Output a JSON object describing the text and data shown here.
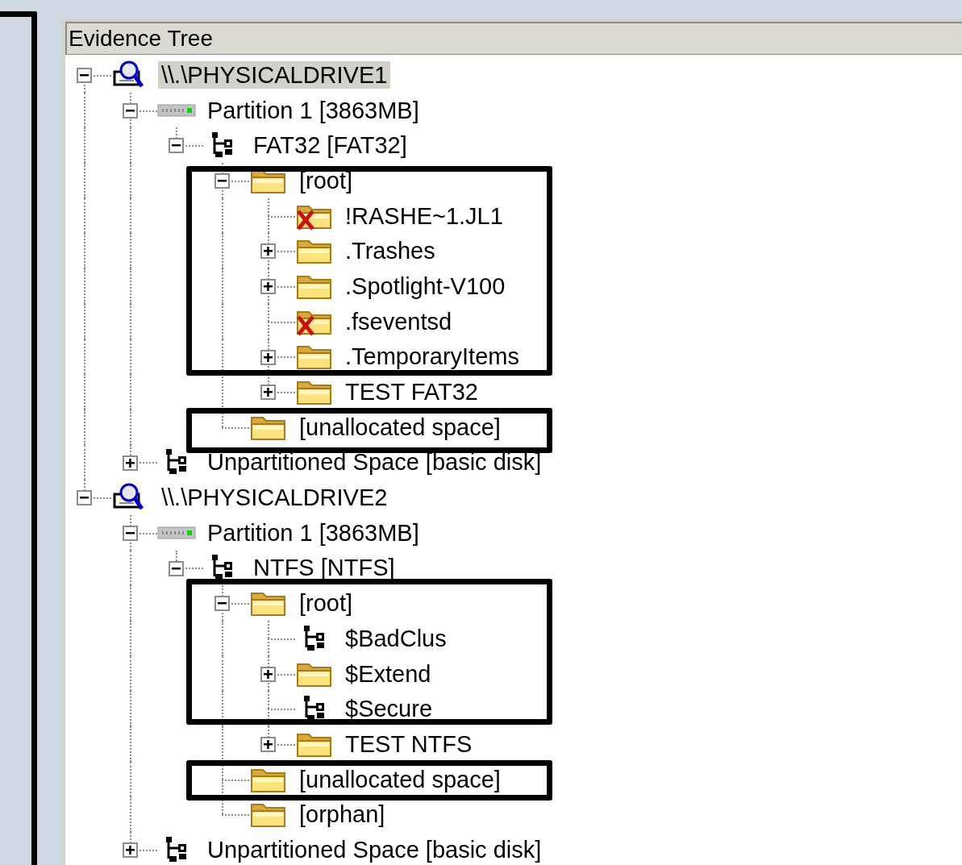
{
  "panel": {
    "title": "Evidence Tree"
  },
  "tree": [
    {
      "label": "\\\\.\\PHYSICALDRIVE1",
      "kind": "drive",
      "selected": true,
      "expanded": true,
      "children": [
        {
          "label": "Partition 1 [3863MB]",
          "kind": "partition",
          "selected": false,
          "expanded": true,
          "children": [
            {
              "label": "FAT32 [FAT32]",
              "kind": "filesystem",
              "selected": false,
              "expanded": true,
              "children": [
                {
                  "label": "[root]",
                  "kind": "folder",
                  "selected": false,
                  "expanded": true,
                  "children": [
                    {
                      "label": "!RASHE~1.JL1",
                      "kind": "deleted-folder",
                      "selected": false
                    },
                    {
                      "label": ".Trashes",
                      "kind": "folder",
                      "selected": false,
                      "expanded": false
                    },
                    {
                      "label": ".Spotlight-V100",
                      "kind": "folder",
                      "selected": false,
                      "expanded": false
                    },
                    {
                      "label": ".fseventsd",
                      "kind": "deleted-folder",
                      "selected": false
                    },
                    {
                      "label": ".TemporaryItems",
                      "kind": "folder",
                      "selected": false,
                      "expanded": false
                    },
                    {
                      "label": "TEST FAT32",
                      "kind": "folder",
                      "selected": false,
                      "expanded": false
                    }
                  ]
                },
                {
                  "label": "[unallocated space]",
                  "kind": "folder",
                  "selected": false
                }
              ]
            }
          ]
        },
        {
          "label": "Unpartitioned Space [basic disk]",
          "kind": "filesystem",
          "selected": false,
          "expanded": false
        }
      ]
    },
    {
      "label": "\\\\.\\PHYSICALDRIVE2",
      "kind": "drive",
      "selected": false,
      "expanded": true,
      "children": [
        {
          "label": "Partition 1 [3863MB]",
          "kind": "partition",
          "selected": false,
          "expanded": true,
          "children": [
            {
              "label": "NTFS [NTFS]",
              "kind": "filesystem",
              "selected": false,
              "expanded": true,
              "children": [
                {
                  "label": "[root]",
                  "kind": "folder",
                  "selected": false,
                  "expanded": true,
                  "children": [
                    {
                      "label": "$BadClus",
                      "kind": "filesystem",
                      "selected": false
                    },
                    {
                      "label": "$Extend",
                      "kind": "folder",
                      "selected": false,
                      "expanded": false
                    },
                    {
                      "label": "$Secure",
                      "kind": "filesystem",
                      "selected": false
                    },
                    {
                      "label": "TEST NTFS",
                      "kind": "folder",
                      "selected": false,
                      "expanded": false
                    }
                  ]
                },
                {
                  "label": "[unallocated space]",
                  "kind": "folder",
                  "selected": false
                },
                {
                  "label": "[orphan]",
                  "kind": "folder",
                  "selected": false
                }
              ]
            }
          ]
        },
        {
          "label": "Unpartitioned Space [basic disk]",
          "kind": "filesystem",
          "selected": false,
          "expanded": false
        }
      ]
    }
  ]
}
